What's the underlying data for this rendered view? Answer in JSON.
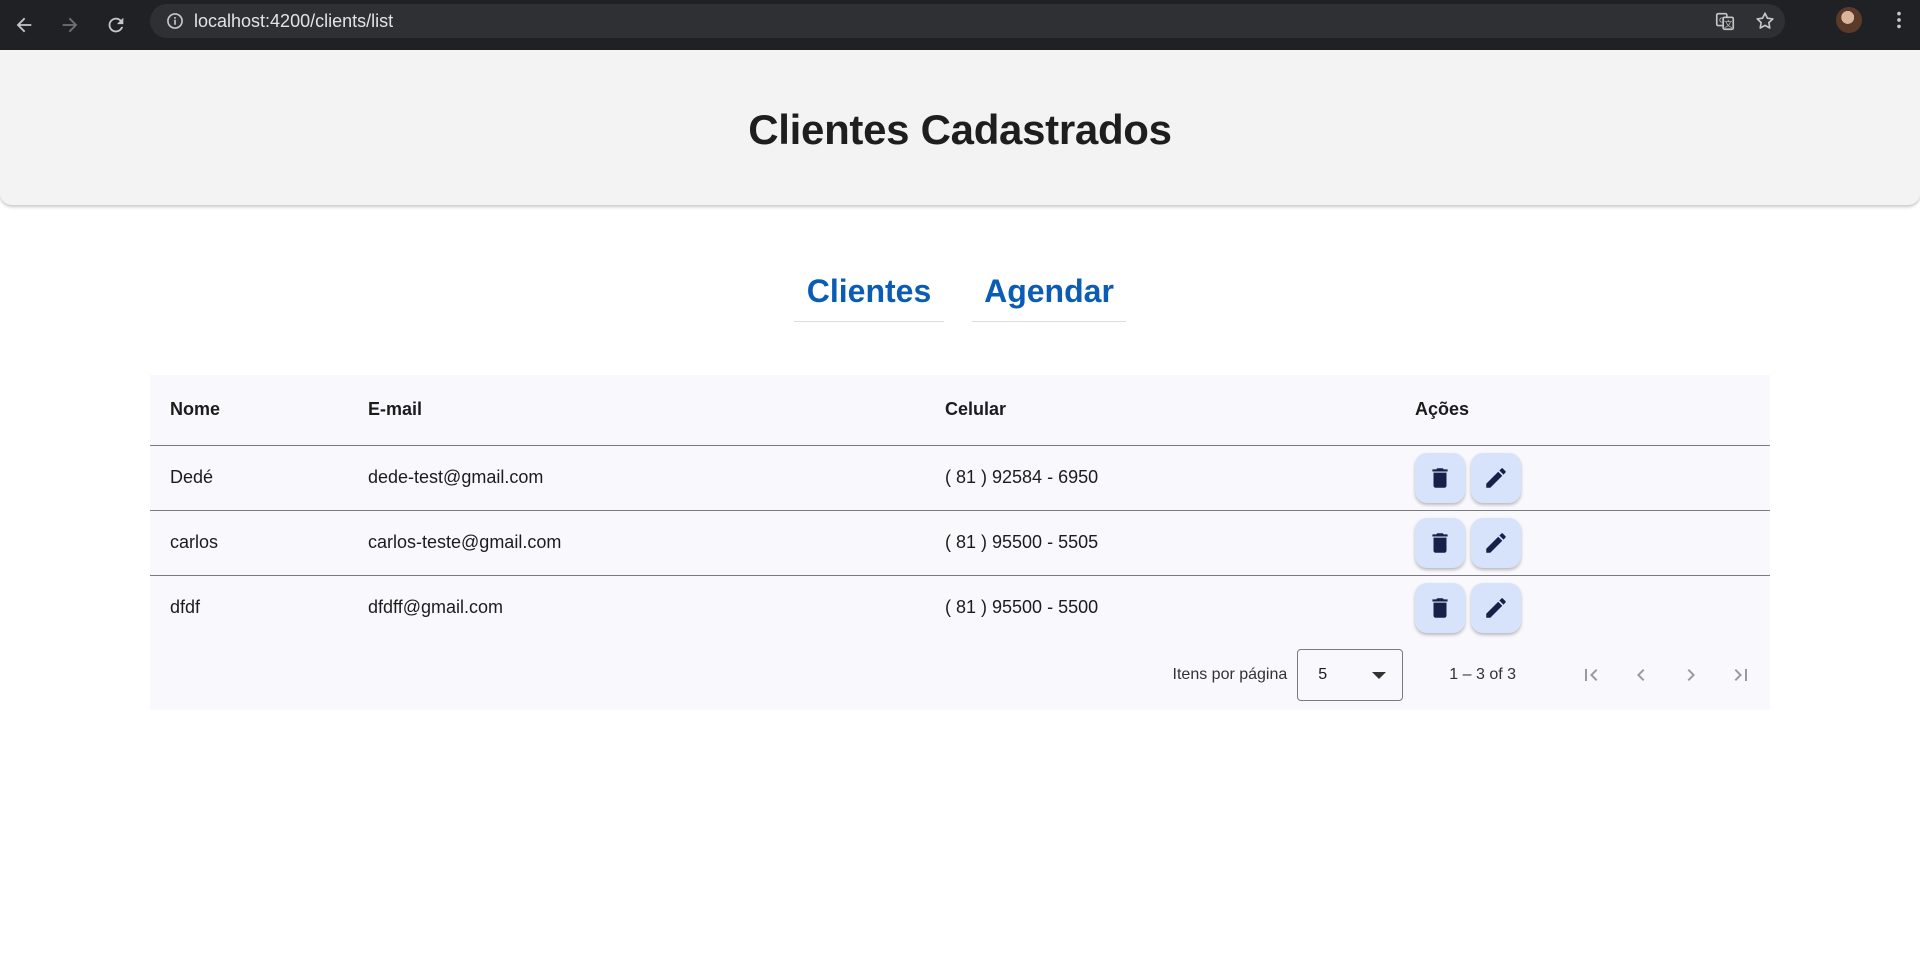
{
  "browser": {
    "url": "localhost:4200/clients/list",
    "icons": [
      "back-arrow-icon",
      "forward-arrow-icon",
      "reload-icon",
      "site-info-icon",
      "translate-icon",
      "bookmark-star-icon",
      "profile-avatar",
      "menu-kebab-icon"
    ]
  },
  "header": {
    "title": "Clientes Cadastrados"
  },
  "tabs": [
    {
      "label": "Clientes"
    },
    {
      "label": "Agendar"
    }
  ],
  "table": {
    "columns": [
      "Nome",
      "E-mail",
      "Celular",
      "Ações"
    ],
    "rows": [
      {
        "nome": "Dedé",
        "email": "dede-test@gmail.com",
        "celular": "( 81 ) 92584 - 6950"
      },
      {
        "nome": "carlos",
        "email": "carlos-teste@gmail.com",
        "celular": "( 81 ) 95500 - 5505"
      },
      {
        "nome": "dfdf",
        "email": "dfdff@gmail.com",
        "celular": "( 81 ) 95500 - 5500"
      }
    ],
    "row_actions": [
      "delete-icon",
      "edit-icon"
    ]
  },
  "paginator": {
    "items_per_page_label": "Itens por página",
    "page_size": "5",
    "range_label": "1 – 3 of 3"
  },
  "colors": {
    "chrome_bg": "#202124",
    "header_bg": "#f3f3f4",
    "tab_color": "#0b5cb5",
    "table_bg": "#f8f8fd",
    "action_button_bg": "#d7e2fb",
    "action_icon": "#16214a"
  }
}
